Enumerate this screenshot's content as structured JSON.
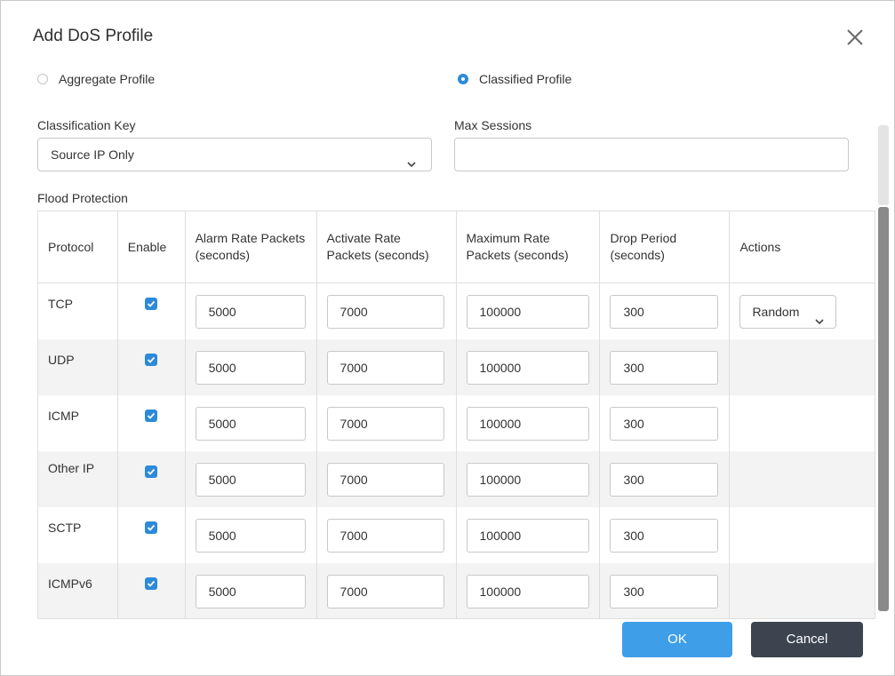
{
  "dialog": {
    "title": "Add DoS Profile",
    "close_icon": "close-icon"
  },
  "profile_type": {
    "options": [
      {
        "label": "Aggregate Profile",
        "selected": false
      },
      {
        "label": "Classified Profile",
        "selected": true
      }
    ]
  },
  "classification_key": {
    "label": "Classification Key",
    "value": "Source IP Only"
  },
  "max_sessions": {
    "label": "Max Sessions",
    "value": ""
  },
  "flood_protection": {
    "label": "Flood Protection",
    "headers": {
      "protocol": "Protocol",
      "enable": "Enable",
      "alarm": "Alarm Rate Packets (seconds)",
      "activate": "Activate Rate Packets (seconds)",
      "maximum": "Maximum Rate Packets (seconds)",
      "drop": "Drop Period (seconds)",
      "actions": "Actions"
    },
    "rows": [
      {
        "protocol": "TCP",
        "enabled": true,
        "alarm": "5000",
        "activate": "7000",
        "maximum": "100000",
        "drop": "300",
        "action": "Random"
      },
      {
        "protocol": "UDP",
        "enabled": true,
        "alarm": "5000",
        "activate": "7000",
        "maximum": "100000",
        "drop": "300",
        "action": null
      },
      {
        "protocol": "ICMP",
        "enabled": true,
        "alarm": "5000",
        "activate": "7000",
        "maximum": "100000",
        "drop": "300",
        "action": null
      },
      {
        "protocol": "Other IP",
        "enabled": true,
        "alarm": "5000",
        "activate": "7000",
        "maximum": "100000",
        "drop": "300",
        "action": null
      },
      {
        "protocol": "SCTP",
        "enabled": true,
        "alarm": "5000",
        "activate": "7000",
        "maximum": "100000",
        "drop": "300",
        "action": null
      },
      {
        "protocol": "ICMPv6",
        "enabled": true,
        "alarm": "5000",
        "activate": "7000",
        "maximum": "100000",
        "drop": "300",
        "action": null
      }
    ]
  },
  "buttons": {
    "ok": "OK",
    "cancel": "Cancel"
  },
  "colors": {
    "accent": "#2d8ad9",
    "ok_button": "#3f9ee8",
    "cancel_button": "#3d4450"
  }
}
